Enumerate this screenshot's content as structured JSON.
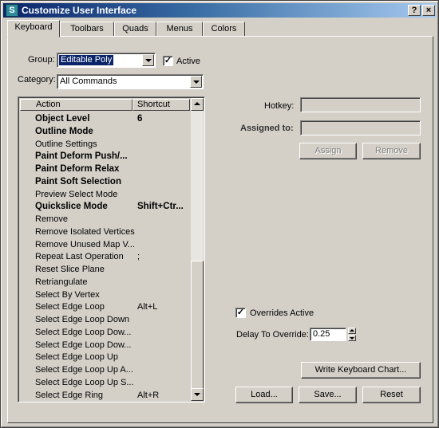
{
  "window": {
    "title": "Customize User Interface",
    "help_label": "?",
    "close_label": "×"
  },
  "tabs": [
    "Keyboard",
    "Toolbars",
    "Quads",
    "Menus",
    "Colors"
  ],
  "group": {
    "label": "Group:",
    "value": "Editable Poly"
  },
  "active": {
    "label": "Active",
    "checked": true
  },
  "category": {
    "label": "Category:",
    "value": "All Commands"
  },
  "list": {
    "headers": {
      "action": "Action",
      "shortcut": "Shortcut"
    },
    "rows": [
      {
        "action": "Object Level",
        "shortcut": "6",
        "bold": true
      },
      {
        "action": "Outline Mode",
        "shortcut": "",
        "bold": true
      },
      {
        "action": "Outline Settings",
        "shortcut": "",
        "bold": false
      },
      {
        "action": "Paint Deform Push/...",
        "shortcut": "",
        "bold": true
      },
      {
        "action": "Paint Deform Relax",
        "shortcut": "",
        "bold": true
      },
      {
        "action": "Paint Soft Selection",
        "shortcut": "",
        "bold": true
      },
      {
        "action": "Preview Select Mode",
        "shortcut": "",
        "bold": false
      },
      {
        "action": "Quickslice Mode",
        "shortcut": "Shift+Ctr...",
        "bold": true
      },
      {
        "action": "Remove",
        "shortcut": "",
        "bold": false
      },
      {
        "action": "Remove Isolated Vertices",
        "shortcut": "",
        "bold": false
      },
      {
        "action": "Remove Unused Map V...",
        "shortcut": "",
        "bold": false
      },
      {
        "action": "Repeat Last Operation",
        "shortcut": ";",
        "bold": false
      },
      {
        "action": "Reset Slice Plane",
        "shortcut": "",
        "bold": false
      },
      {
        "action": "Retriangulate",
        "shortcut": "",
        "bold": false
      },
      {
        "action": "Select By Vertex",
        "shortcut": "",
        "bold": false
      },
      {
        "action": "Select Edge Loop",
        "shortcut": "Alt+L",
        "bold": false
      },
      {
        "action": "Select Edge Loop Down",
        "shortcut": "",
        "bold": false
      },
      {
        "action": "Select Edge Loop Dow...",
        "shortcut": "",
        "bold": false
      },
      {
        "action": "Select Edge Loop Dow...",
        "shortcut": "",
        "bold": false
      },
      {
        "action": "Select Edge Loop Up",
        "shortcut": "",
        "bold": false
      },
      {
        "action": "Select Edge Loop Up A...",
        "shortcut": "",
        "bold": false
      },
      {
        "action": "Select Edge Loop Up S...",
        "shortcut": "",
        "bold": false
      },
      {
        "action": "Select Edge Ring",
        "shortcut": "Alt+R",
        "bold": false
      }
    ]
  },
  "hotkey": {
    "label": "Hotkey:",
    "value": ""
  },
  "assigned_to": {
    "label": "Assigned to:",
    "value": ""
  },
  "buttons": {
    "assign": "Assign",
    "remove": "Remove",
    "write_chart": "Write Keyboard Chart...",
    "load": "Load...",
    "save": "Save...",
    "reset": "Reset"
  },
  "overrides": {
    "label": "Overrides Active",
    "checked": true
  },
  "delay": {
    "label": "Delay To Override:",
    "value": "0.25"
  },
  "colors": {
    "title_start": "#0a246a",
    "title_end": "#a6caf0",
    "face": "#d4d0c8",
    "selection": "#0a246a"
  }
}
